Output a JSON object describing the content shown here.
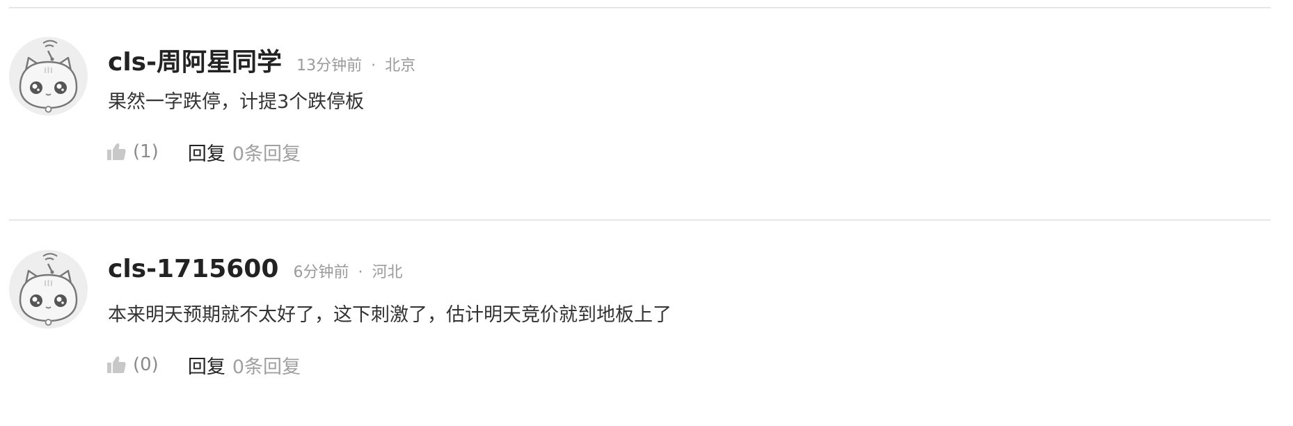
{
  "comments": [
    {
      "username": "cls-周阿星同学",
      "time": "13分钟前",
      "separator": "·",
      "location": "北京",
      "content": "果然一字跌停，计提3个跌停板",
      "likes": "(1)",
      "reply_label": "回复",
      "reply_count": "0条回复",
      "avatar_icon": "cat-robot-avatar-icon",
      "like_icon": "thumbs-up-icon"
    },
    {
      "username": "cls-1715600",
      "time": "6分钟前",
      "separator": "·",
      "location": "河北",
      "content": "本来明天预期就不太好了，这下刺激了，估计明天竞价就到地板上了",
      "likes": "(0)",
      "reply_label": "回复",
      "reply_count": "0条回复",
      "avatar_icon": "cat-robot-avatar-icon",
      "like_icon": "thumbs-up-icon"
    }
  ],
  "colors": {
    "username": "#222222",
    "meta": "#9a9a9a",
    "content": "#333333",
    "muted": "#a0a0a0",
    "divider": "#e6e6e6",
    "icon": "#c8c8c8"
  }
}
